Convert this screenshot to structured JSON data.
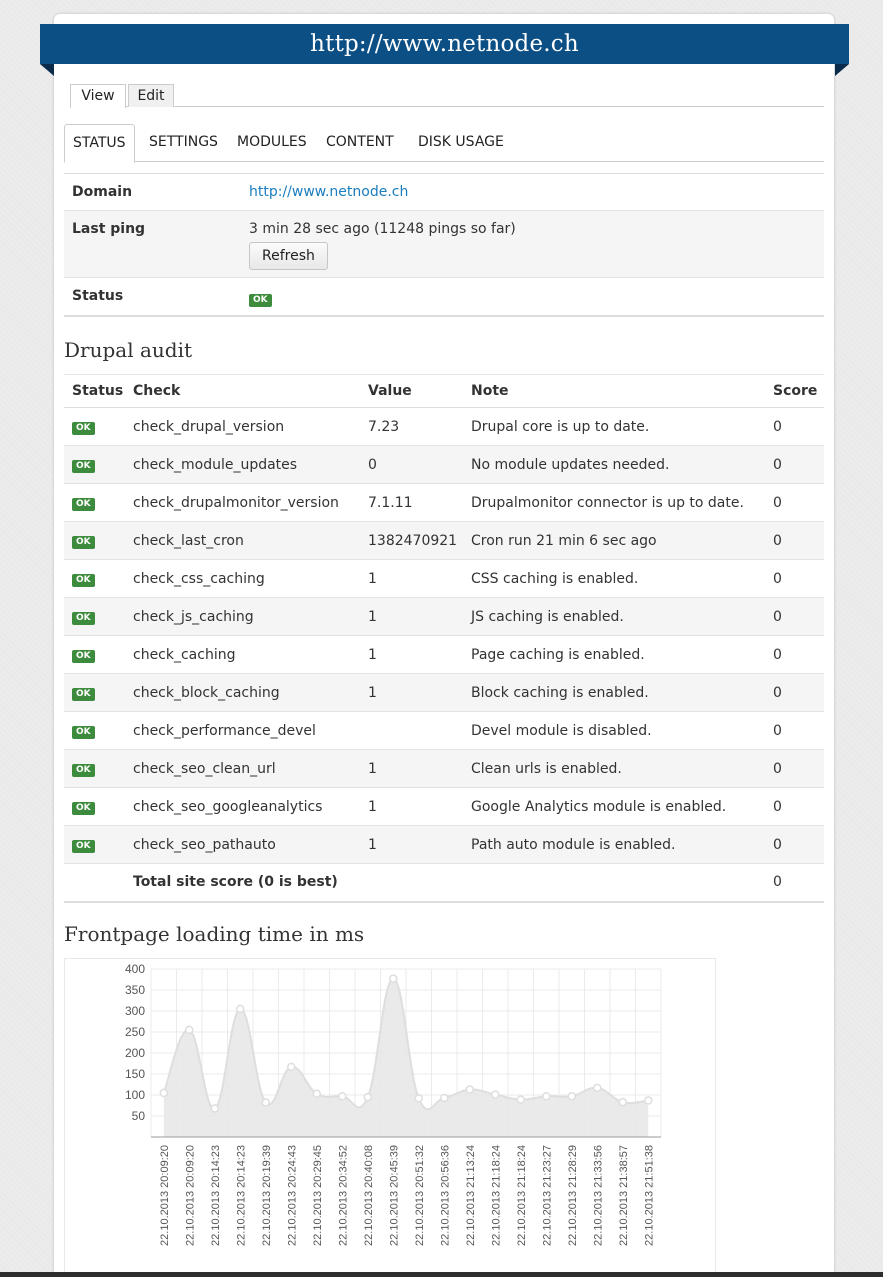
{
  "site": {
    "title": "http://www.netnode.ch"
  },
  "view_tabs": [
    {
      "label": "View"
    },
    {
      "label": "Edit"
    }
  ],
  "section_tabs": [
    {
      "label": "STATUS"
    },
    {
      "label": "SETTINGS"
    },
    {
      "label": "MODULES"
    },
    {
      "label": "CONTENT"
    },
    {
      "label": "DISK USAGE"
    }
  ],
  "info": {
    "domain_label": "Domain",
    "domain_value": "http://www.netnode.ch",
    "ping_label": "Last ping",
    "ping_value": "3 min 28 sec ago (11248 pings so far)",
    "refresh_label": "Refresh",
    "status_label": "Status",
    "status_value": "OK"
  },
  "audit": {
    "heading": "Drupal audit",
    "columns": [
      "Status",
      "Check",
      "Value",
      "Note",
      "Score"
    ],
    "rows": [
      {
        "status": "OK",
        "check": "check_drupal_version",
        "value": "7.23",
        "note": "Drupal core is up to date.",
        "score": "0"
      },
      {
        "status": "OK",
        "check": "check_module_updates",
        "value": "0",
        "note": "No module updates needed.",
        "score": "0"
      },
      {
        "status": "OK",
        "check": "check_drupalmonitor_version",
        "value": "7.1.11",
        "note": "Drupalmonitor connector is up to date.",
        "score": "0"
      },
      {
        "status": "OK",
        "check": "check_last_cron",
        "value": "1382470921",
        "note": "Cron run 21 min 6 sec ago",
        "score": "0"
      },
      {
        "status": "OK",
        "check": "check_css_caching",
        "value": "1",
        "note": "CSS caching is enabled.",
        "score": "0"
      },
      {
        "status": "OK",
        "check": "check_js_caching",
        "value": "1",
        "note": "JS caching is enabled.",
        "score": "0"
      },
      {
        "status": "OK",
        "check": "check_caching",
        "value": "1",
        "note": "Page caching is enabled.",
        "score": "0"
      },
      {
        "status": "OK",
        "check": "check_block_caching",
        "value": "1",
        "note": "Block caching is enabled.",
        "score": "0"
      },
      {
        "status": "OK",
        "check": "check_performance_devel",
        "value": "",
        "note": "Devel module is disabled.",
        "score": "0"
      },
      {
        "status": "OK",
        "check": "check_seo_clean_url",
        "value": "1",
        "note": "Clean urls is enabled.",
        "score": "0"
      },
      {
        "status": "OK",
        "check": "check_seo_googleanalytics",
        "value": "1",
        "note": "Google Analytics module is enabled.",
        "score": "0"
      },
      {
        "status": "OK",
        "check": "check_seo_pathauto",
        "value": "1",
        "note": "Path auto module is enabled.",
        "score": "0"
      }
    ],
    "total_label": "Total site score (0 is best)",
    "total_score": "0"
  },
  "chart_heading": "Frontpage loading time in ms",
  "chart_data": {
    "type": "area",
    "title": "",
    "xlabel": "",
    "ylabel": "",
    "ylim": [
      0,
      400
    ],
    "yticks": [
      50,
      100,
      150,
      200,
      250,
      300,
      350,
      400
    ],
    "grid": true,
    "x": [
      "22.10.2013 20:09:20",
      "22.10.2013 20:09:20",
      "22.10.2013 20:14:23",
      "22.10.2013 20:14:23",
      "22.10.2013 20:19:39",
      "22.10.2013 20:24:43",
      "22.10.2013 20:29:45",
      "22.10.2013 20:34:52",
      "22.10.2013 20:40:08",
      "22.10.2013 20:45:39",
      "22.10.2013 20:51:32",
      "22.10.2013 20:56:36",
      "22.10.2013 21:13:24",
      "22.10.2013 21:18:24",
      "22.10.2013 21:18:24",
      "22.10.2013 21:23:27",
      "22.10.2013 21:28:29",
      "22.10.2013 21:33:56",
      "22.10.2013 21:38:57",
      "22.10.2013 21:51:38"
    ],
    "series": [
      {
        "values": [
          105,
          255,
          68,
          305,
          82,
          167,
          103,
          97,
          95,
          377,
          92,
          93,
          113,
          101,
          89,
          97,
          97,
          117,
          83,
          87
        ]
      }
    ],
    "colors": {
      "fill": "#e8e8e8",
      "line": "#dedede",
      "point_fill": "#ffffff",
      "grid": "#ebebeb"
    }
  }
}
